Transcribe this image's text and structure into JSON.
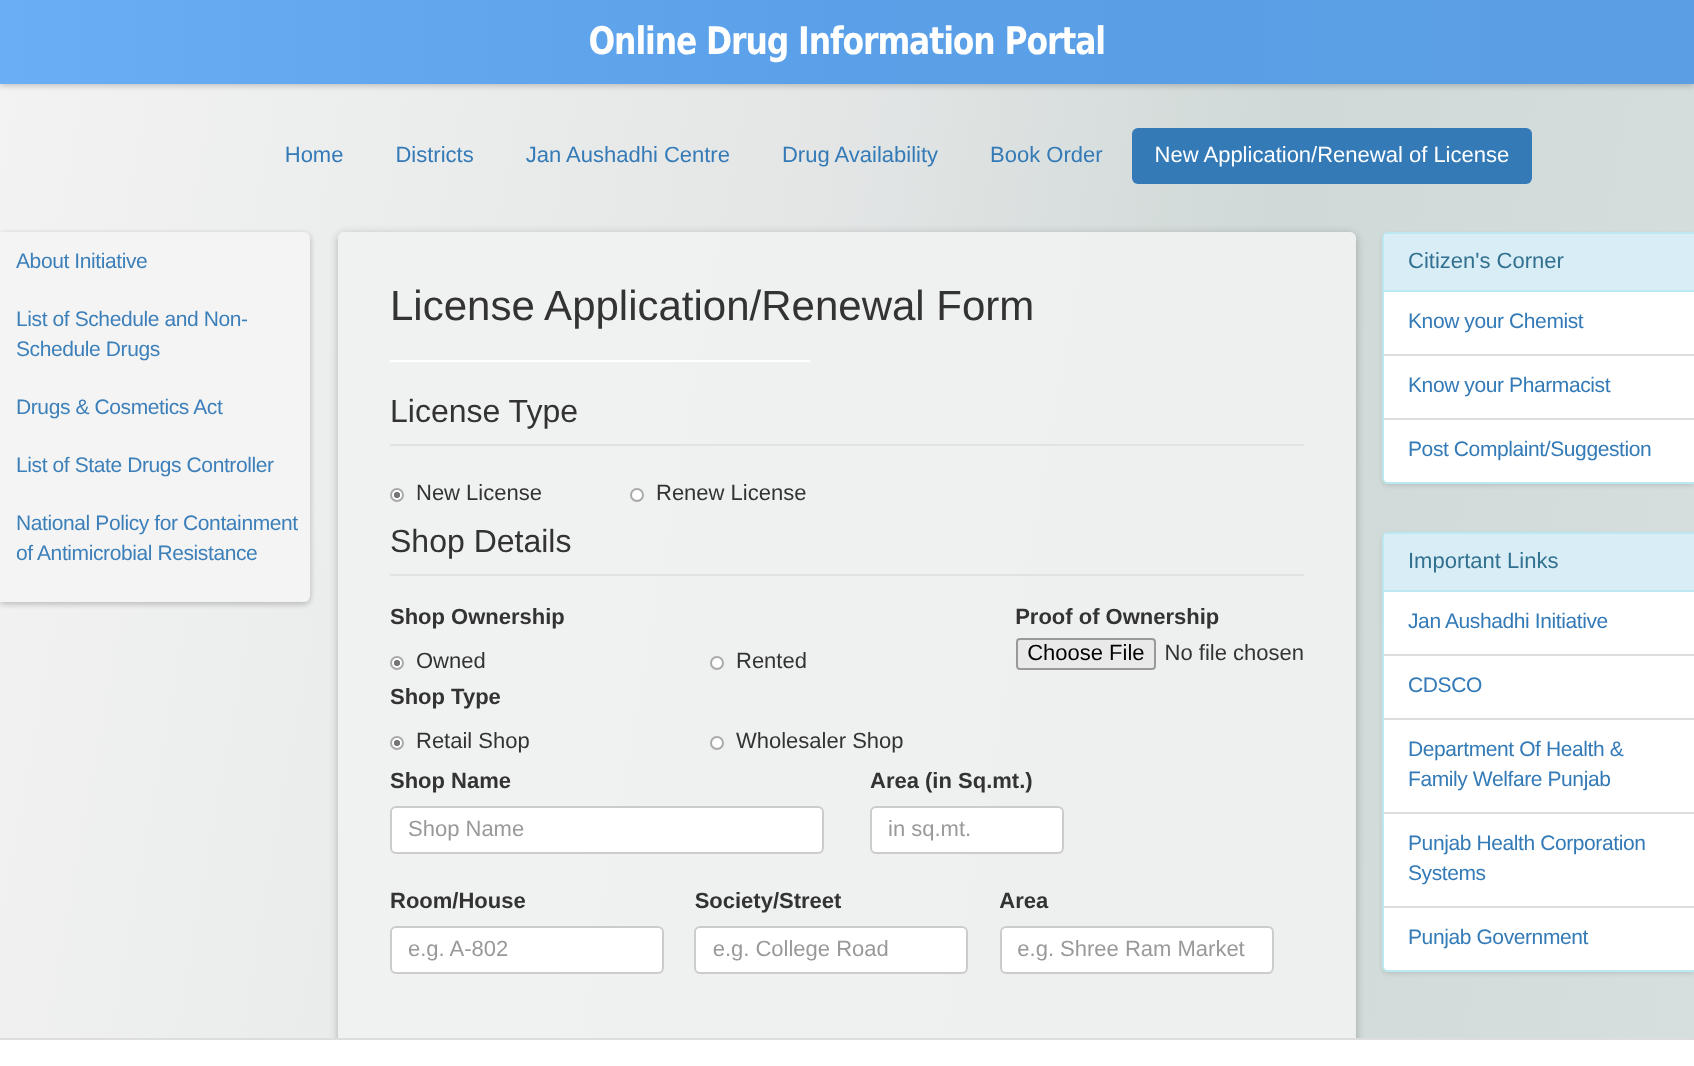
{
  "header": {
    "title": "Online Drug Information Portal"
  },
  "nav": [
    {
      "label": "Home",
      "selected": false
    },
    {
      "label": "Districts",
      "selected": false
    },
    {
      "label": "Jan Aushadhi Centre",
      "selected": false
    },
    {
      "label": "Drug Availability",
      "selected": false
    },
    {
      "label": "Book Order",
      "selected": false
    },
    {
      "label": "New Application/Renewal of License",
      "selected": true
    }
  ],
  "left_sidebar": {
    "items": [
      "About Initiative",
      "List of Schedule and Non-Schedule Drugs",
      "Drugs & Cosmetics Act",
      "List of State Drugs Controller",
      "National Policy for Containment of Antimicrobial Resistance"
    ]
  },
  "form": {
    "title": "License Application/Renewal Form",
    "license_type": {
      "heading": "License Type",
      "options": [
        {
          "label": "New License",
          "selected": true
        },
        {
          "label": "Renew License",
          "selected": false
        }
      ]
    },
    "shop_details": {
      "heading": "Shop Details",
      "ownership": {
        "label": "Shop Ownership",
        "options": [
          {
            "label": "Owned",
            "selected": true
          },
          {
            "label": "Rented",
            "selected": false
          }
        ]
      },
      "proof": {
        "label": "Proof of Ownership",
        "button": "Choose File",
        "status": "No file chosen"
      },
      "shop_type": {
        "label": "Shop Type",
        "options": [
          {
            "label": "Retail Shop",
            "selected": true
          },
          {
            "label": "Wholesaler Shop",
            "selected": false
          }
        ]
      },
      "shop_name": {
        "label": "Shop Name",
        "placeholder": "Shop Name"
      },
      "area_size": {
        "label": "Area (in Sq.mt.)",
        "placeholder": "in sq.mt."
      },
      "address": [
        {
          "label": "Room/House",
          "placeholder": "e.g. A-802"
        },
        {
          "label": "Society/Street",
          "placeholder": "e.g. College Road"
        },
        {
          "label": "Area",
          "placeholder": "e.g. Shree Ram Market"
        }
      ]
    }
  },
  "right_sidebar": [
    {
      "heading": "Citizen's Corner",
      "items": [
        "Know your Chemist",
        "Know your Pharmacist",
        "Post Complaint/Suggestion"
      ]
    },
    {
      "heading": "Important Links",
      "items": [
        "Jan Aushadhi Initiative",
        "CDSCO",
        "Department Of Health & Family Welfare Punjab",
        "Punjab Health Corporation Systems",
        "Punjab Government"
      ]
    }
  ]
}
